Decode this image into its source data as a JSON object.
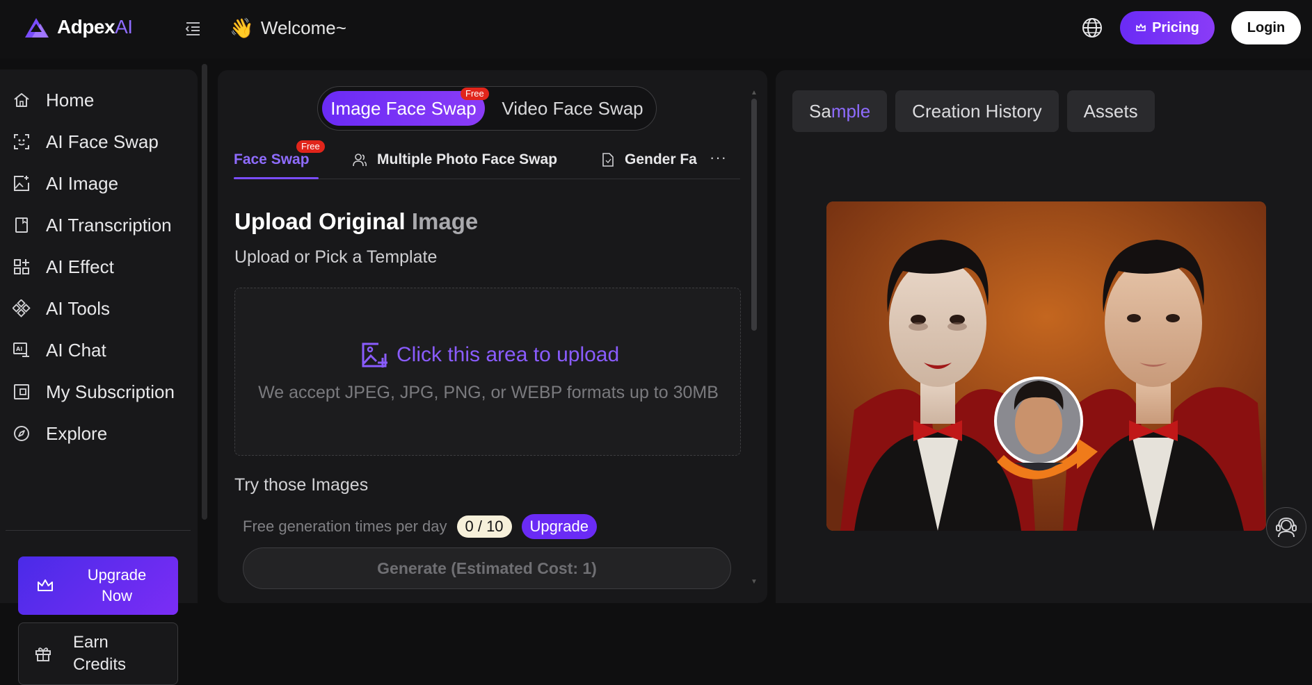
{
  "header": {
    "logo_text": "Adpex",
    "logo_ai": "AI",
    "welcome": "Welcome~",
    "wave_emoji": "👋",
    "pricing_label": "Pricing",
    "login_label": "Login"
  },
  "sidebar": {
    "items": [
      {
        "label": "Home",
        "icon": "home-icon"
      },
      {
        "label": "AI Face Swap",
        "icon": "face-scan-icon"
      },
      {
        "label": "AI Image",
        "icon": "image-plus-icon"
      },
      {
        "label": "AI Transcription",
        "icon": "document-icon"
      },
      {
        "label": "AI Effect",
        "icon": "grid-plus-icon"
      },
      {
        "label": "AI Tools",
        "icon": "tools-icon"
      },
      {
        "label": "AI Chat",
        "icon": "chat-ai-icon"
      },
      {
        "label": "My Subscription",
        "icon": "subscription-icon"
      },
      {
        "label": "Explore",
        "icon": "compass-icon"
      }
    ],
    "upgrade_label": "Upgrade Now",
    "earn_label": "Earn Credits"
  },
  "main": {
    "mode_tabs": [
      {
        "label": "Image Face Swap",
        "badge": "Free",
        "active": true
      },
      {
        "label": "Video Face Swap",
        "active": false
      }
    ],
    "sub_tabs": [
      {
        "label": "Face Swap",
        "badge": "Free",
        "active": true
      },
      {
        "label": "Multiple Photo Face Swap",
        "active": false
      },
      {
        "label": "Gender Fa",
        "active": false
      }
    ],
    "more_label": "···",
    "upload_title_a": "Upload Original",
    "upload_title_b": "Image",
    "upload_subtitle": "Upload or Pick a Template",
    "dropzone_cta": "Click this area to upload",
    "dropzone_hint": "We accept JPEG, JPG, PNG, or WEBP formats up to 30MB",
    "try_title": "Try those Images",
    "free_label": "Free generation times per day",
    "free_count": "0 / 10",
    "free_upgrade": "Upgrade",
    "generate_label": "Generate (Estimated Cost: 1)"
  },
  "right": {
    "tabs": [
      {
        "label_a": "Sa",
        "label_b": "mple"
      },
      {
        "label": "Creation History"
      },
      {
        "label": "Assets"
      }
    ]
  },
  "colors": {
    "accent": "#7b4dff",
    "accent_gradient_start": "#6a2bf5",
    "badge_red": "#e1251b",
    "background": "#0f0f10",
    "panel": "#18181a"
  }
}
